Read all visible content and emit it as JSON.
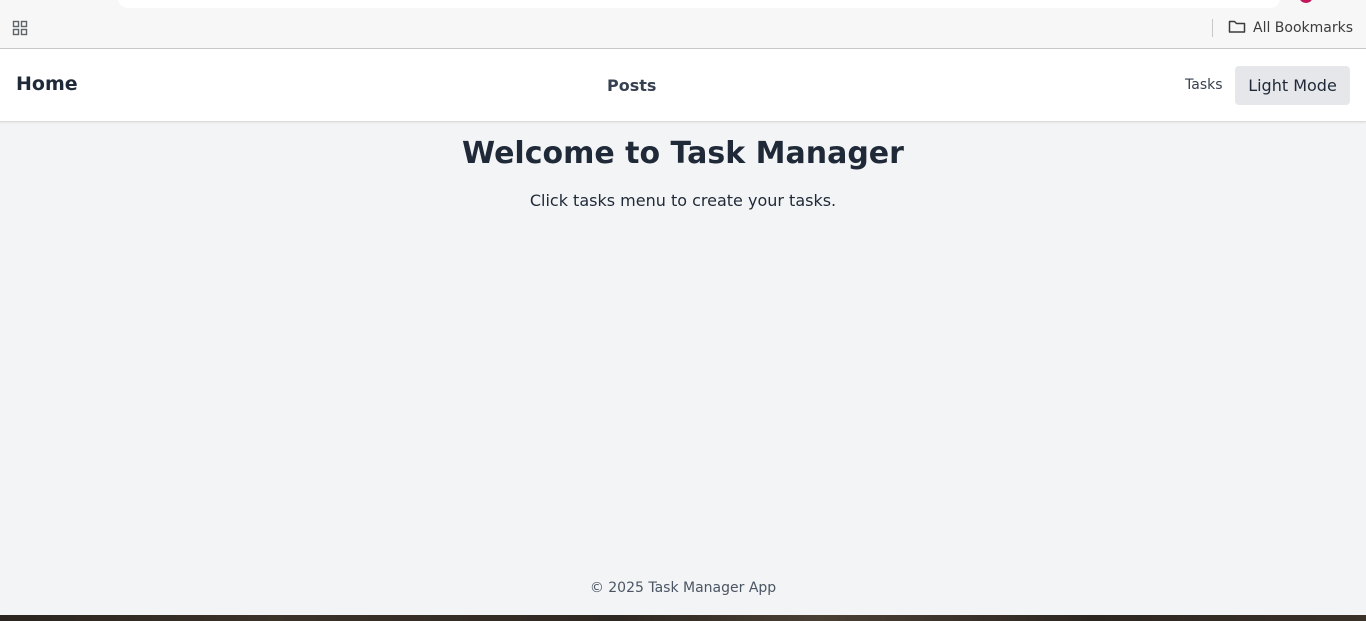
{
  "browser": {
    "bookmarks_label": "All Bookmarks"
  },
  "navbar": {
    "home_label": "Home",
    "posts_label": "Posts",
    "tasks_label": "Tasks",
    "mode_button_label": "Light Mode"
  },
  "main": {
    "title": "Welcome to Task Manager",
    "subtitle": "Click tasks menu to create your tasks."
  },
  "footer": {
    "text": "© 2025 Task Manager App"
  },
  "colors": {
    "page_bg": "#f3f4f6",
    "navbar_bg": "#ffffff",
    "button_bg": "#e5e7eb",
    "heading_text": "#1f2937",
    "muted_text": "#4b5563"
  },
  "icons": {
    "apps": "apps-grid-icon",
    "bookmarks": "folder-icon"
  }
}
